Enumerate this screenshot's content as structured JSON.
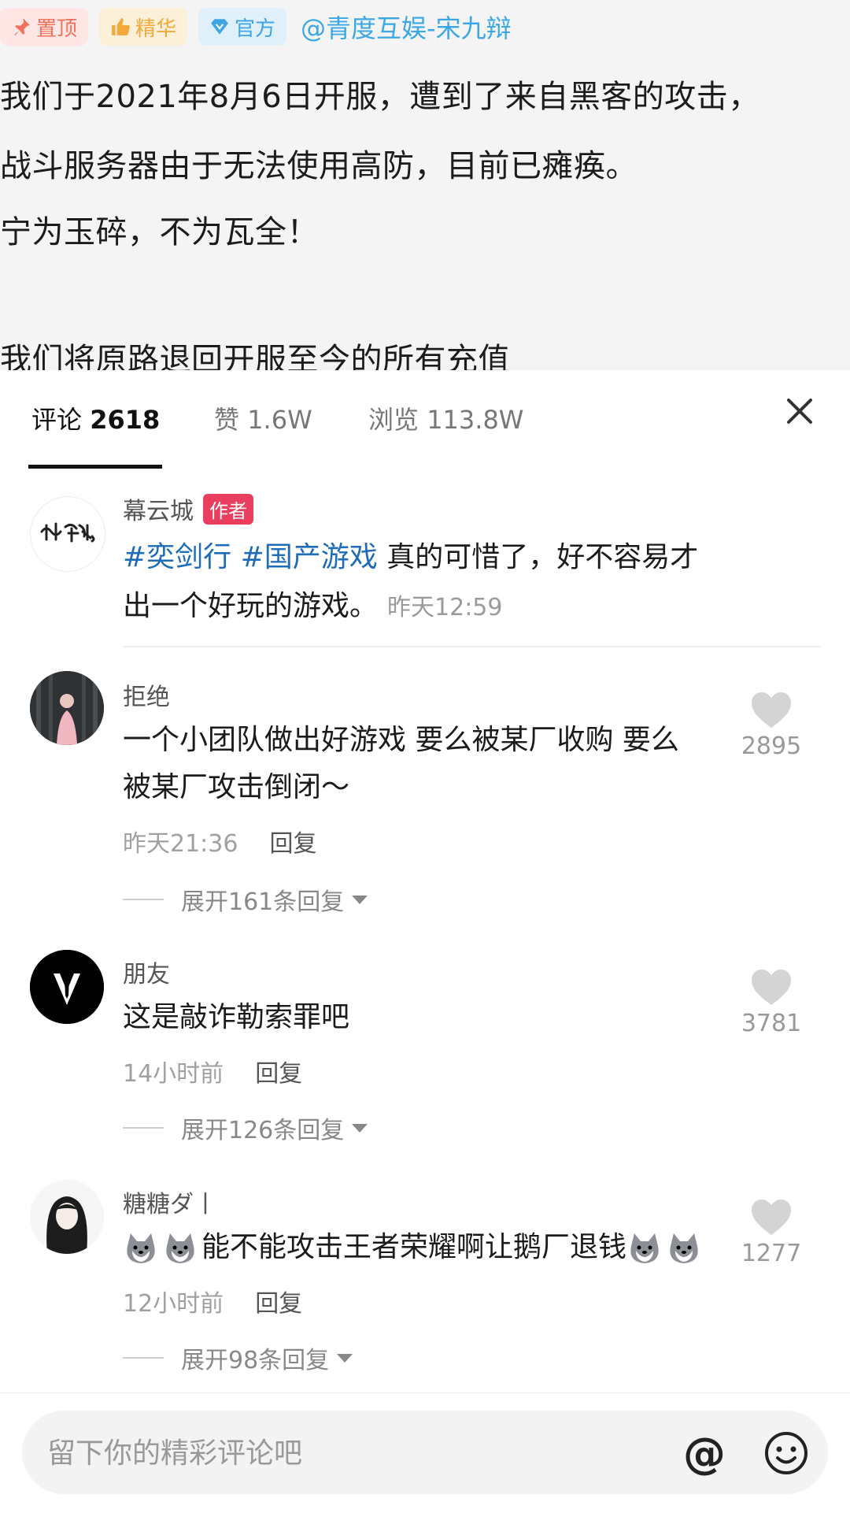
{
  "post": {
    "tags": {
      "pinned": "置顶",
      "featured": "精华",
      "official": "官方"
    },
    "author_link": "@青度互娱-宋九辩",
    "lines": [
      "我们于2021年8月6日开服，遭到了来自黑客的攻击，",
      "战斗服务器由于无法使用高防，目前已瘫痪。",
      "宁为玉碎，不为瓦全！",
      "我们将原路退回开服至今的所有充值"
    ]
  },
  "stats": {
    "comments_label": "评论",
    "comments_count": "2618",
    "likes_label": "赞",
    "likes_count": "1.6W",
    "views_label": "浏览",
    "views_count": "113.8W"
  },
  "author_comment": {
    "name": "幕云城",
    "badge": "作者",
    "hashtag1": "#奕剑行",
    "hashtag2": "#国产游戏",
    "text_line1": "真的可惜了，好不容易才",
    "text_line2": "出一个好玩的游戏。",
    "time": "昨天12:59"
  },
  "comments": [
    {
      "name": "拒绝",
      "line1": "一个小团队做出好游戏 要么被某厂收购 要么",
      "line2": "被某厂攻击倒闭～",
      "time": "昨天21:36",
      "reply": "回复",
      "likes": "2895",
      "expand": "展开161条回复"
    },
    {
      "name": "朋友",
      "line1": "这是敲诈勒索罪吧",
      "time": "14小时前",
      "reply": "回复",
      "likes": "3781",
      "expand": "展开126条回复"
    },
    {
      "name": "糖糖ダ丨",
      "line1": "能不能攻击王者荣耀啊让鹅厂退钱",
      "time": "12小时前",
      "reply": "回复",
      "likes": "1277",
      "expand": "展开98条回复"
    }
  ],
  "input": {
    "placeholder": "留下你的精彩评论吧",
    "at_symbol": "@"
  },
  "colors": {
    "hashtag": "#1f6db8",
    "author_badge": "#ea3e5e",
    "link": "#3aa7e6"
  }
}
